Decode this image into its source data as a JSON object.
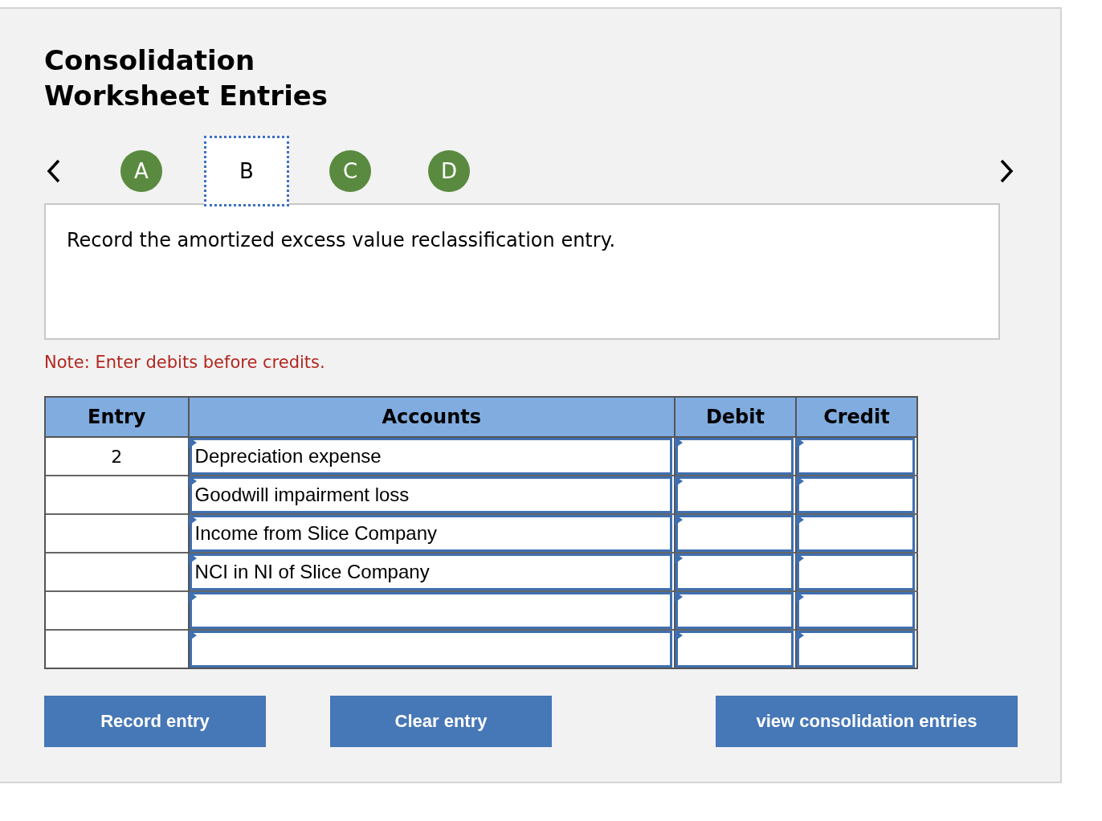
{
  "title_lines": [
    "Consolidation",
    "Worksheet Entries"
  ],
  "tabs": [
    {
      "label": "A",
      "selected": false
    },
    {
      "label": "B",
      "selected": true
    },
    {
      "label": "C",
      "selected": false
    },
    {
      "label": "D",
      "selected": false
    }
  ],
  "instruction": "Record the amortized excess value reclassification entry.",
  "note": "Note: Enter debits before credits.",
  "table": {
    "columns": [
      "Entry",
      "Accounts",
      "Debit",
      "Credit"
    ],
    "rows": [
      {
        "entry": "2",
        "account": "Depreciation expense"
      },
      {
        "account": "Goodwill impairment loss"
      },
      {
        "account": "Income from Slice Company"
      },
      {
        "account": "NCI in NI of Slice Company"
      },
      {},
      {}
    ]
  },
  "buttons": [
    "Record entry",
    "Clear entry",
    "view consolidation entries"
  ]
}
